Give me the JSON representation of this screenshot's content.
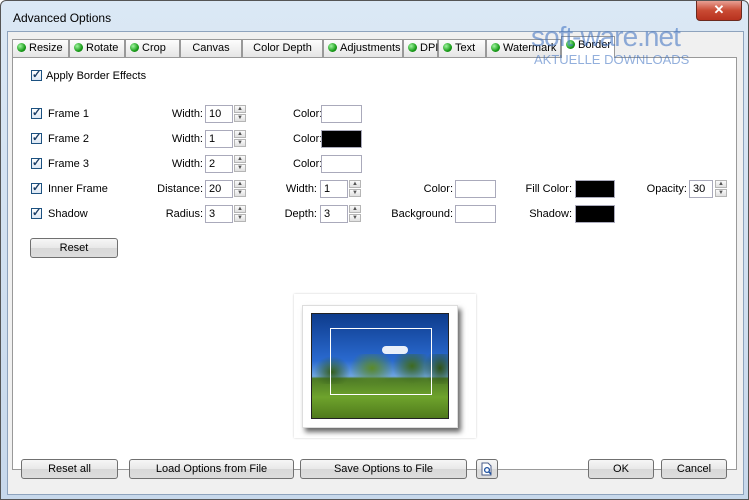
{
  "window": {
    "title": "Advanced Options",
    "close_glyph": "✕"
  },
  "tabs": [
    {
      "label": "Resize",
      "status": "green"
    },
    {
      "label": "Rotate",
      "status": "green"
    },
    {
      "label": "Crop",
      "status": "green"
    },
    {
      "label": "Canvas",
      "status": ""
    },
    {
      "label": "Color Depth",
      "status": ""
    },
    {
      "label": "Adjustments",
      "status": "green"
    },
    {
      "label": "DPI",
      "status": "green"
    },
    {
      "label": "Text",
      "status": "green"
    },
    {
      "label": "Watermark",
      "status": "green"
    },
    {
      "label": "Border",
      "status": "green",
      "active": true
    }
  ],
  "border": {
    "apply_label": "Apply Border Effects",
    "apply_checked": true,
    "frame1": {
      "label": "Frame 1",
      "width_label": "Width:",
      "width": "10",
      "color_label": "Color:",
      "color": "#FFFFFF"
    },
    "frame2": {
      "label": "Frame 2",
      "width_label": "Width:",
      "width": "1",
      "color_label": "Color:",
      "color": "#000000"
    },
    "frame3": {
      "label": "Frame 3",
      "width_label": "Width:",
      "width": "2",
      "color_label": "Color:",
      "color": "#FFFFFF"
    },
    "inner": {
      "label": "Inner Frame",
      "distance_label": "Distance:",
      "distance": "20",
      "width_label": "Width:",
      "width": "1",
      "color_label": "Color:",
      "color": "#FFFFFF",
      "fill_label": "Fill Color:",
      "fill": "#000000",
      "opacity_label": "Opacity:",
      "opacity": "30"
    },
    "shadow": {
      "label": "Shadow",
      "radius_label": "Radius:",
      "radius": "3",
      "depth_label": "Depth:",
      "depth": "3",
      "background_label": "Background:",
      "background": "#FFFFFF",
      "shadow_label": "Shadow:",
      "shadow": "#000000"
    },
    "reset_label": "Reset"
  },
  "footer": {
    "reset_all": "Reset all",
    "load": "Load Options from File",
    "save": "Save Options to File",
    "ok": "OK",
    "cancel": "Cancel"
  },
  "watermark": {
    "brand": "soft-ware.net",
    "tagline": "AKTUELLE DOWNLOADS"
  }
}
